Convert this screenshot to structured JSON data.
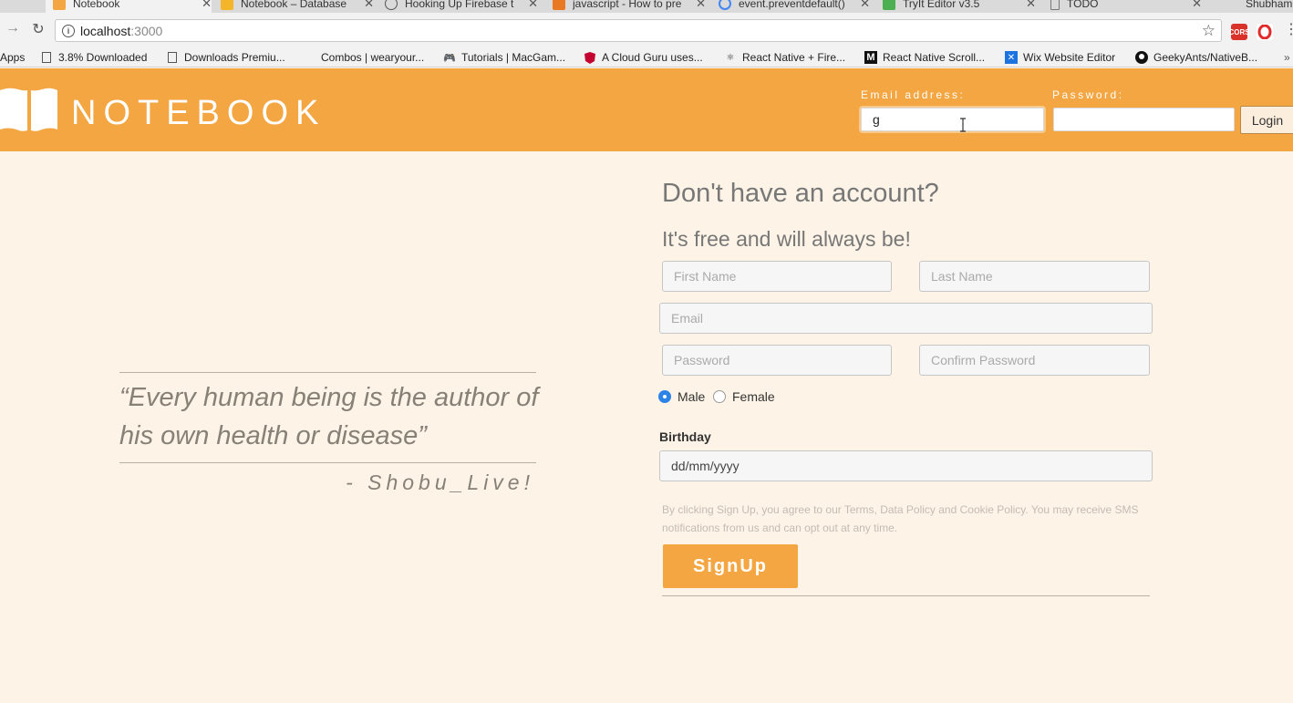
{
  "browser": {
    "tabs": [
      {
        "title": "Notebook",
        "active": true
      },
      {
        "title": "Notebook – Database",
        "active": false
      },
      {
        "title": "Hooking Up Firebase t",
        "active": false
      },
      {
        "title": "javascript - How to pre",
        "active": false
      },
      {
        "title": "event.preventdefault()",
        "active": false
      },
      {
        "title": "TryIt Editor v3.5",
        "active": false
      },
      {
        "title": "TODO",
        "active": false
      }
    ],
    "profile_name": "Shubham",
    "url_host": "localhost",
    "url_port": ":3000",
    "extensions": [
      {
        "name": "cors-extension-icon",
        "label": "CORS",
        "color": "#d9322b"
      },
      {
        "name": "opera-extension-icon",
        "label": "",
        "color": "#e22a2a"
      }
    ],
    "bookmarks": [
      {
        "label": "Apps",
        "icon": "apps-grid-icon"
      },
      {
        "label": "3.8% Downloaded",
        "icon": "page-icon"
      },
      {
        "label": "Downloads Premiu...",
        "icon": "page-icon"
      },
      {
        "label": "Combos | wearyour...",
        "icon": ""
      },
      {
        "label": "Tutorials | MacGam...",
        "icon": "gamepad-icon"
      },
      {
        "label": "A Cloud Guru uses...",
        "icon": "angular-icon"
      },
      {
        "label": "React Native + Fire...",
        "icon": "react-icon"
      },
      {
        "label": "React Native Scroll...",
        "icon": "medium-icon"
      },
      {
        "label": "Wix Website Editor",
        "icon": "wix-icon"
      },
      {
        "label": "GeekyAnts/NativeB...",
        "icon": "github-icon"
      }
    ]
  },
  "header": {
    "brand": "NOTEBOOK",
    "email_label": "Email address:",
    "email_value": "g",
    "password_label": "Password:",
    "password_value": "",
    "login_label": "Login",
    "accent_color": "#f4a642"
  },
  "quote": {
    "text": "“Every human being is the author of his own health or disease”",
    "author": "- Shobu_Live!"
  },
  "signup": {
    "title": "Don't have an account?",
    "subtitle": "It's free and will always be!",
    "first_name_placeholder": "First Name",
    "last_name_placeholder": "Last Name",
    "email_placeholder": "Email",
    "password_placeholder": "Password",
    "confirm_password_placeholder": "Confirm Password",
    "gender_male": "Male",
    "gender_female": "Female",
    "gender_selected": "Male",
    "birthday_label": "Birthday",
    "birthday_value": "dd/mm/yyyy",
    "terms": "By clicking Sign Up, you agree to our Terms, Data Policy and Cookie Policy. You may receive SMS notifications from us and can opt out at any time.",
    "button_label": "SignUp"
  }
}
